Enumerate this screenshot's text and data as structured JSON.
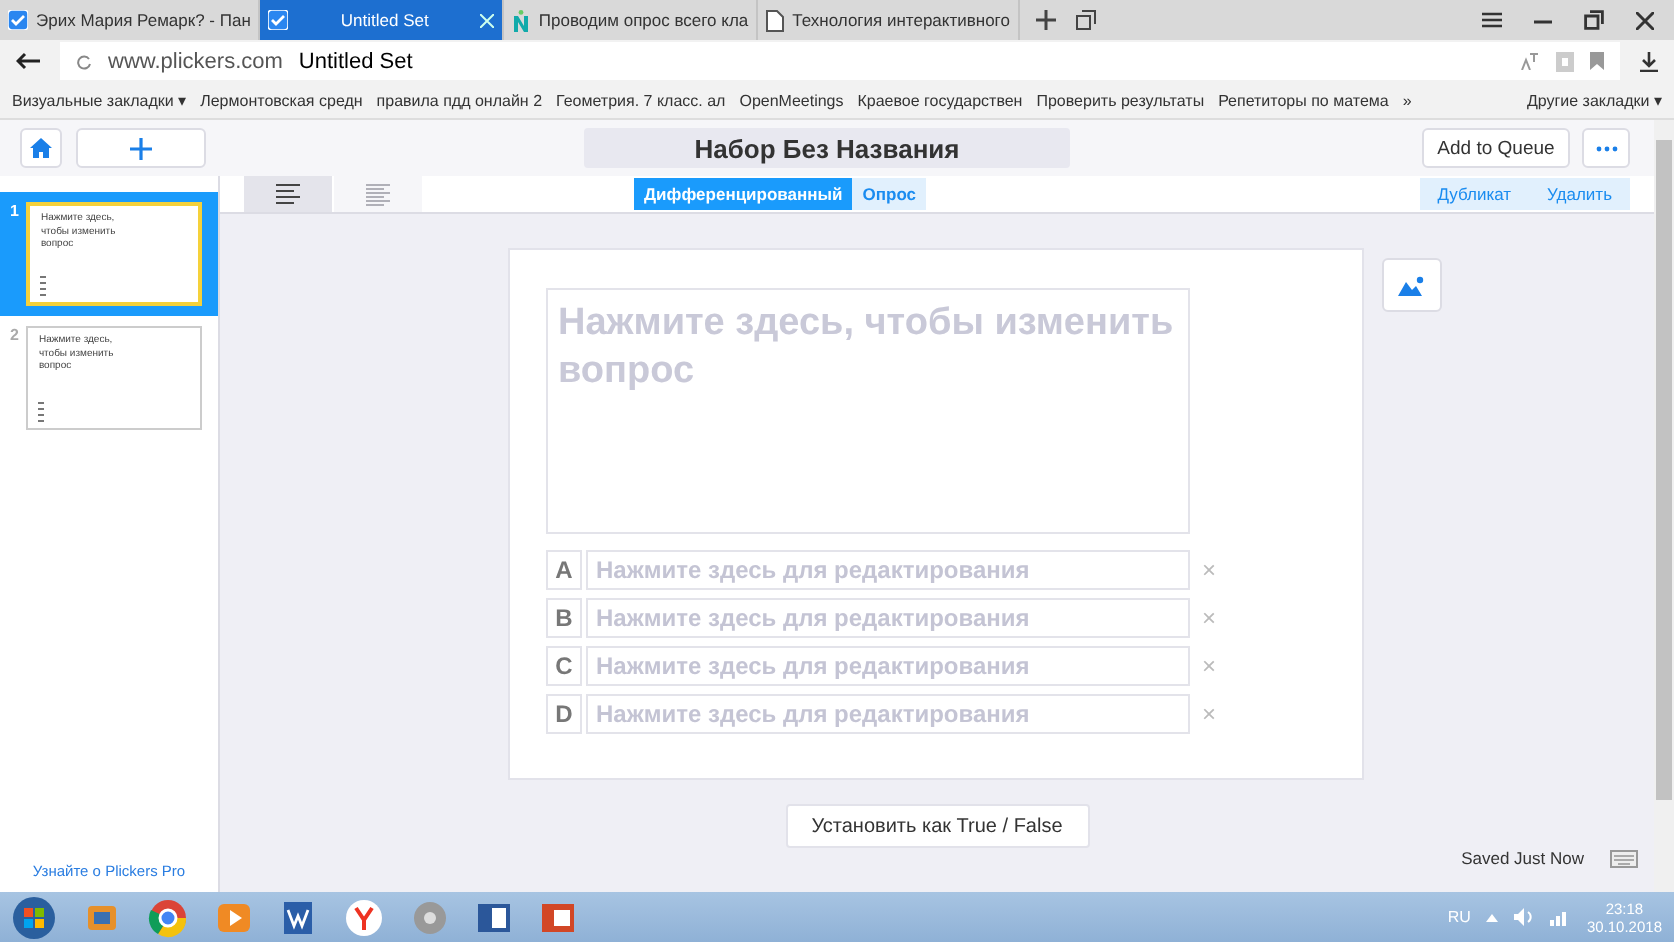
{
  "browser": {
    "tabs": [
      {
        "title": "Эрих Мария Ремарк? - Пан",
        "selected": false
      },
      {
        "title": "Untitled Set",
        "selected": true
      },
      {
        "title": "Проводим опрос всего кла",
        "selected": false
      },
      {
        "title": "Технология интерактивного",
        "selected": false
      }
    ],
    "address": {
      "domain": "www.plickers.com",
      "page_title": "Untitled Set"
    },
    "bookmarks": [
      "Визуальные закладки ▾",
      "Лермонтовская средн",
      "правила пдд онлайн 2",
      "Геометрия. 7 класс. ал",
      "OpenMeetings",
      "Краевое государствен",
      "Проверить результаты",
      "Репетиторы по матема",
      "»"
    ],
    "other_bookmarks": "Другие закладки ▾"
  },
  "app": {
    "title": "Набор Без Названия",
    "add_to_queue": "Add to Queue",
    "slides": [
      {
        "number": "1",
        "question": "Нажмите здесь, чтобы изменить вопрос",
        "selected": true
      },
      {
        "number": "2",
        "question": "Нажмите здесь, чтобы изменить вопрос",
        "selected": false
      }
    ],
    "view_toggles": [
      {
        "kind": "full",
        "selected": true
      },
      {
        "kind": "compact",
        "selected": false
      }
    ],
    "mode_tabs": [
      {
        "label": "Дифференцированный",
        "selected": true
      },
      {
        "label": "Опрос",
        "selected": false
      }
    ],
    "actions": [
      "Дубликат",
      "Удалить"
    ],
    "question": {
      "placeholder": "Нажмите здесь, чтобы изменить вопрос"
    },
    "answers": [
      {
        "letter": "A",
        "placeholder": "Нажмите здесь для редактирования"
      },
      {
        "letter": "B",
        "placeholder": "Нажмите здесь для редактирования"
      },
      {
        "letter": "C",
        "placeholder": "Нажмите здесь для редактирования"
      },
      {
        "letter": "D",
        "placeholder": "Нажмите здесь для редактирования"
      }
    ],
    "remove_mark": "×",
    "true_false_button": "Установить как True / False",
    "promo_link": "Узнайте о Plickers Pro",
    "save_status": "Saved Just Now"
  },
  "taskbar": {
    "language": "RU",
    "time": "23:18",
    "date": "30.10.2018"
  }
}
